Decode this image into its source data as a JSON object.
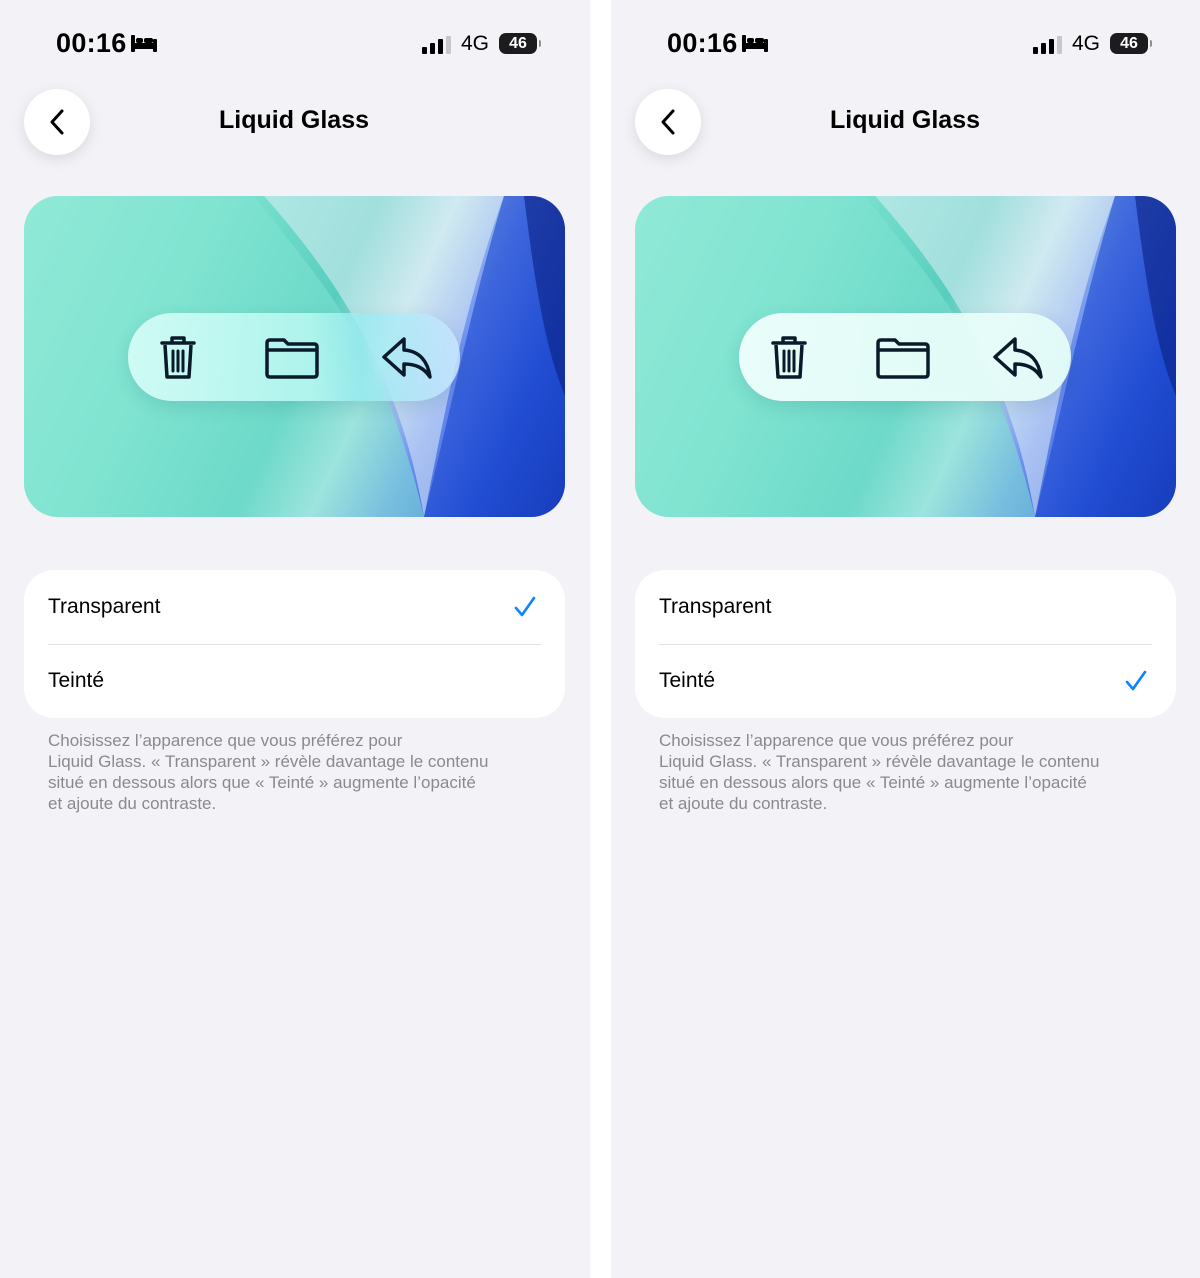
{
  "screens": [
    {
      "status_bar": {
        "time": "00:16",
        "network": "4G",
        "battery": "46",
        "focus_icon": "bed-icon"
      },
      "nav": {
        "title": "Liquid Glass",
        "back_icon": "chevron-left-icon"
      },
      "preview": {
        "toolbar_icons": [
          "trash-icon",
          "folder-icon",
          "reply-icon"
        ]
      },
      "options": [
        {
          "label": "Transparent",
          "selected": true
        },
        {
          "label": "Teinté",
          "selected": false
        }
      ],
      "description_lines": [
        "Choisissez l’apparence que vous préférez pour",
        "Liquid Glass. « Transparent » révèle davantage le contenu",
        "situé en dessous alors que « Teinté » augmente l’opacité",
        "et ajoute du contraste."
      ]
    },
    {
      "status_bar": {
        "time": "00:16",
        "network": "4G",
        "battery": "46",
        "focus_icon": "bed-icon"
      },
      "nav": {
        "title": "Liquid Glass",
        "back_icon": "chevron-left-icon"
      },
      "preview": {
        "toolbar_icons": [
          "trash-icon",
          "folder-icon",
          "reply-icon"
        ]
      },
      "options": [
        {
          "label": "Transparent",
          "selected": false
        },
        {
          "label": "Teinté",
          "selected": true
        }
      ],
      "description_lines": [
        "Choisissez l’apparence que vous préférez pour",
        "Liquid Glass. « Transparent » révèle davantage le contenu",
        "situé en dessous alors que « Teinté » augmente l’opacité",
        "et ajoute du contraste."
      ]
    }
  ],
  "colors": {
    "accent": "#0a84ff",
    "background": "#f2f2f7",
    "card": "#ffffff",
    "secondary_text": "#8a8a8e"
  }
}
